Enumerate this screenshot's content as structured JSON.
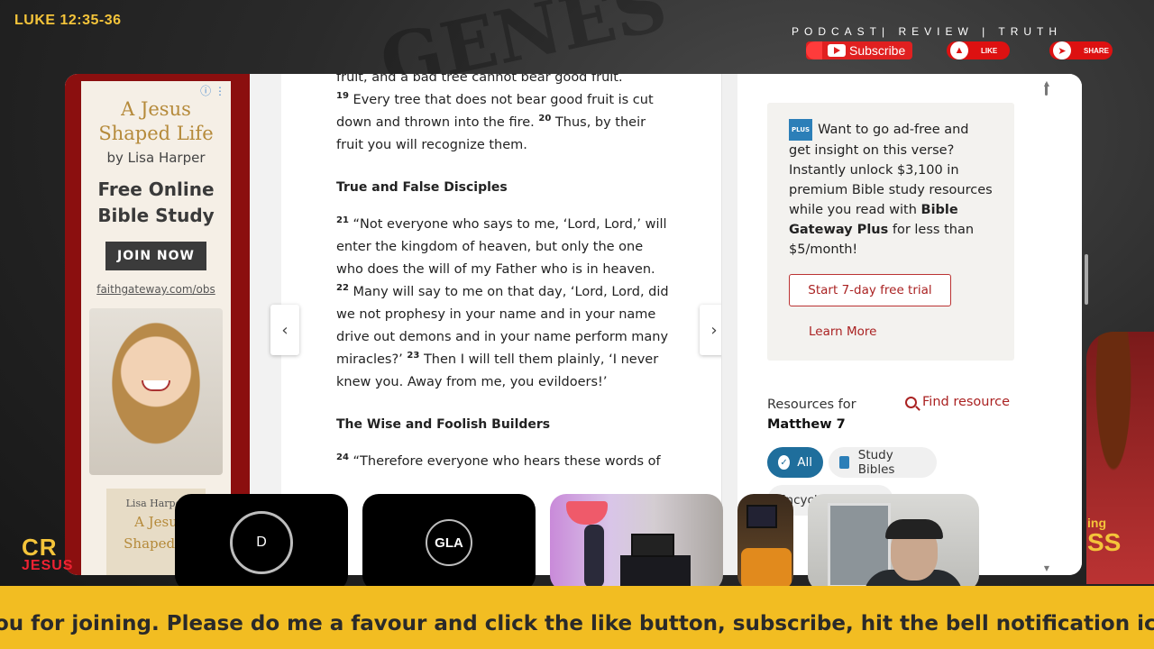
{
  "overlay": {
    "verse_reference": "LUKE 12:35-36",
    "tagline": "PODCAST| REVIEW | TRUTH",
    "subscribe_label": "Subscribe",
    "like_label": "LIKE",
    "share_label": "SHARE",
    "left_brand_line1": "CR",
    "left_brand_line2": "JESUS",
    "right_brand_line1": "ing",
    "right_brand_line2": "SS",
    "ticker_text": "ou for joining. Please do me a favour and click the like button, subscribe, hit the bell notification ico"
  },
  "ad": {
    "title_line1": "A Jesus",
    "title_line2": "Shaped Life",
    "author": "by Lisa Harper",
    "headline_line1": "Free Online",
    "headline_line2": "Bible Study",
    "button_label": "JOIN NOW",
    "link": "faithgateway.com/obs",
    "book_author": "Lisa Harper",
    "book_title_line1": "A Jesu",
    "book_title_line2": "Shaped L"
  },
  "reader": {
    "top_fragment": "fruit, and a bad tree cannot bear good fruit.",
    "v19_num": "19",
    "v19": "Every tree that does not bear good fruit is cut down and thrown into the fire.",
    "v20_num": "20",
    "v20": "Thus, by their fruit you will recognize them.",
    "heading1": "True and False Disciples",
    "v21_num": "21",
    "v21": "“Not everyone who says to me, ‘Lord, Lord,’ will enter the kingdom of heaven, but only the one who does the will of my Father who is in heaven.",
    "v22_num": "22",
    "v22": "Many will say to me on that day, ‘Lord, Lord, did we not prophesy in your name and in your name drive out demons and in your name perform many miracles?’",
    "v23_num": "23",
    "v23": "Then I will tell them plainly, ‘I never knew you. Away from me, you evildoers!’",
    "heading2": "The Wise and Foolish Builders",
    "v24_num": "24",
    "v24": "“Therefore everyone who hears these words of"
  },
  "sidebar": {
    "plus_badge": "PLUS",
    "promo_text": "Want to go ad-free and get insight on this verse? Instantly unlock $3,100 in premium Bible study resources while you read with",
    "promo_bold": "Bible Gateway Plus",
    "promo_tail": "for less than $5/month!",
    "trial_button": "Start 7-day free trial",
    "learn_more": "Learn More",
    "resources_for": "Resources for",
    "resources_book": "Matthew 7",
    "find_resource": "Find resource",
    "chip_all": "All",
    "chip_study": "Study Bibles",
    "chip_other": "Encyclopedias"
  },
  "participants": [
    {
      "initials": "D"
    },
    {
      "initials": "GLA"
    }
  ]
}
